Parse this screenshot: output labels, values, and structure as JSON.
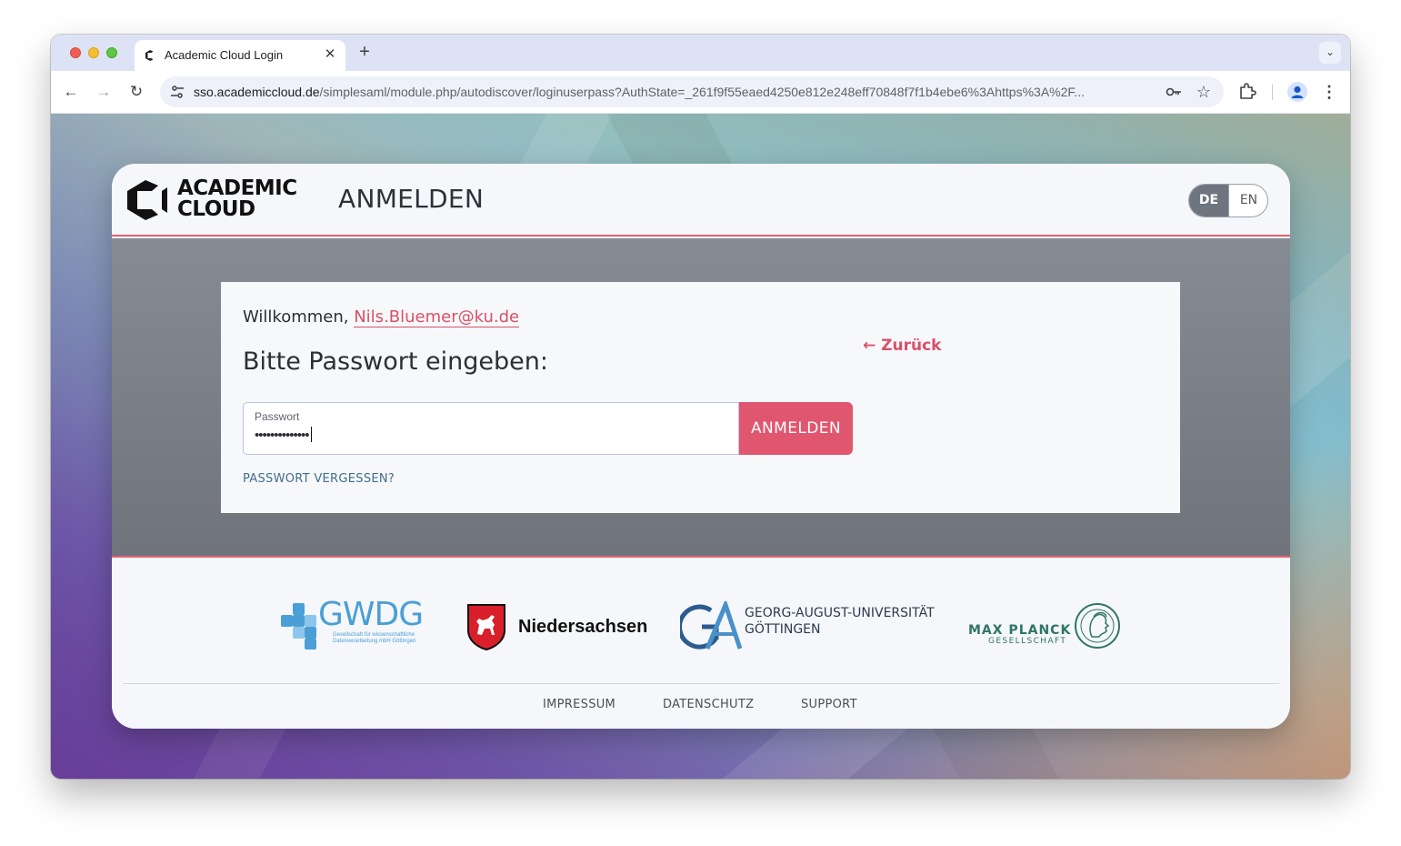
{
  "browser": {
    "tab": {
      "title": "Academic Cloud Login",
      "favicon": "academic-cloud-icon",
      "close": "✕"
    },
    "new_tab": "+",
    "url": {
      "host": "sso.academiccloud.de",
      "path": "/simplesaml/module.php/autodiscover/loginuserpass?AuthState=_261f9f55eaed4250e812e248eff70848f7f1b4ebe6%3Ahttps%3A%2F..."
    },
    "nav": {
      "back": "←",
      "forward": "→",
      "reload": "↻"
    },
    "star": "☆",
    "menu": "⋮"
  },
  "header": {
    "logo_line1": "ACADEMIC",
    "logo_line2": "CLOUD",
    "title": "ANMELDEN",
    "lang": {
      "de": "DE",
      "en": "EN",
      "selected": "DE"
    }
  },
  "login": {
    "welcome_prefix": "Willkommen,",
    "email": "Nils.Bluemer@ku.de",
    "heading": "Bitte Passwort eingeben:",
    "back_link": "← Zurück",
    "password_label": "Passwort",
    "password_masked": "••••••••••••••",
    "submit": "ANMELDEN",
    "forgot": "PASSWORT VERGESSEN?"
  },
  "partners": {
    "gwdg": {
      "name": "GWDG",
      "sub_line1": "Gesellschaft für wissenschaftliche",
      "sub_line2": "Datenverarbeitung mbH Göttingen"
    },
    "niedersachsen": {
      "name": "Niedersachsen"
    },
    "goettingen": {
      "line1": "GEORG-AUGUST-UNIVERSITÄT",
      "line2": "GÖTTINGEN"
    },
    "max_planck": {
      "name": "MAX PLANCK",
      "sub": "GESELLSCHAFT"
    }
  },
  "footer": {
    "links": [
      "IMPRESSUM",
      "DATENSCHUTZ",
      "SUPPORT"
    ]
  },
  "colors": {
    "accent": "#e0566f",
    "link": "#d9506a",
    "forgot_link": "#3f6e8e",
    "lang_active": "#6f757e"
  }
}
